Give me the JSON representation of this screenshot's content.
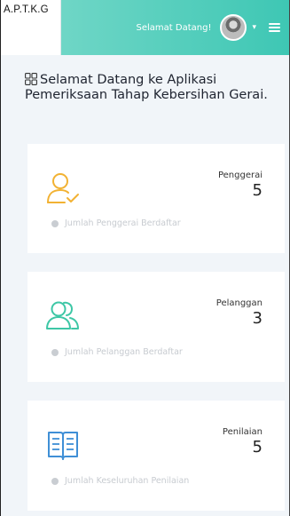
{
  "brand": {
    "name": "A.P.T.K.G"
  },
  "topbar": {
    "greeting": "Selamat Datang!",
    "chevron": "▾"
  },
  "page": {
    "heading": "Selamat Datang ke Aplikasi Pemeriksaan Tahap Kebersihan Gerai."
  },
  "cards": [
    {
      "label": "Penggerai",
      "value": "5",
      "footer": "Jumlah Penggerai Berdaftar",
      "icon": "user-check-icon",
      "icon_color": "#f2b233"
    },
    {
      "label": "Pelanggan",
      "value": "3",
      "footer": "Jumlah Pelanggan Berdaftar",
      "icon": "users-icon",
      "icon_color": "#3ec7a6"
    },
    {
      "label": "Penilaian",
      "value": "5",
      "footer": "Jumlah Keseluruhan Penilaian",
      "icon": "book-open-icon",
      "icon_color": "#3f8fd6"
    }
  ],
  "colors": {
    "topbar": "#4ecbb9",
    "background": "#f1f5f9",
    "card": "#ffffff"
  }
}
